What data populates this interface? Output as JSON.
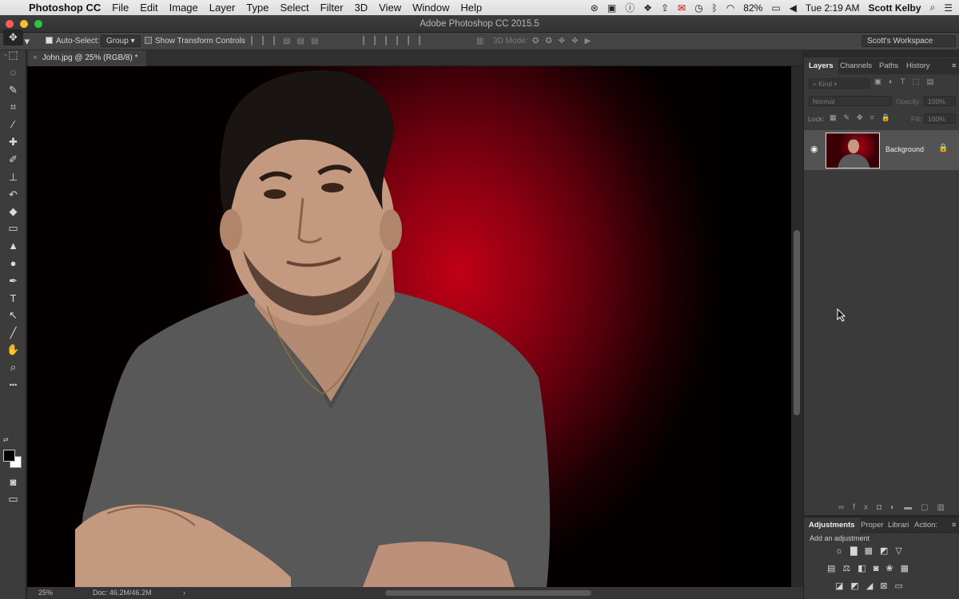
{
  "menubar": {
    "app_name": "Photoshop CC",
    "items": [
      "File",
      "Edit",
      "Image",
      "Layer",
      "Type",
      "Select",
      "Filter",
      "3D",
      "View",
      "Window",
      "Help"
    ],
    "battery": "82%",
    "clock": "Tue 2:19 AM",
    "user": "Scott Kelby"
  },
  "window": {
    "title": "Adobe Photoshop CC 2015.5"
  },
  "options": {
    "auto_select_label": "Auto-Select:",
    "auto_select_checked": true,
    "auto_select_value": "Group",
    "show_transform_label": "Show Transform Controls",
    "mode_3d_label": "3D Mode:",
    "workspace": "Scott's Workspace"
  },
  "document": {
    "tab_title": "John.jpg @ 25% (RGB/8) *",
    "zoom": "25%",
    "doc_info": "Doc: 46.2M/46.2M"
  },
  "tools": {
    "items": [
      {
        "icon": "move-icon",
        "glyph": "✥"
      },
      {
        "icon": "marquee-icon",
        "glyph": "⬚"
      },
      {
        "icon": "lasso-icon",
        "glyph": "◌"
      },
      {
        "icon": "quick-select-icon",
        "glyph": "✎"
      },
      {
        "icon": "crop-icon",
        "glyph": "⌗"
      },
      {
        "icon": "eyedropper-icon",
        "glyph": "⁄"
      },
      {
        "icon": "healing-icon",
        "glyph": "✚"
      },
      {
        "icon": "brush-icon",
        "glyph": "✐"
      },
      {
        "icon": "stamp-icon",
        "glyph": "⊥"
      },
      {
        "icon": "history-brush-icon",
        "glyph": "↶"
      },
      {
        "icon": "eraser-icon",
        "glyph": "◆"
      },
      {
        "icon": "gradient-icon",
        "glyph": "▭"
      },
      {
        "icon": "blur-icon",
        "glyph": "▲"
      },
      {
        "icon": "dodge-icon",
        "glyph": "●"
      },
      {
        "icon": "pen-icon",
        "glyph": "✒"
      },
      {
        "icon": "type-icon",
        "glyph": "T"
      },
      {
        "icon": "path-select-icon",
        "glyph": "↖"
      },
      {
        "icon": "line-icon",
        "glyph": "╱"
      },
      {
        "icon": "hand-icon",
        "glyph": "✋"
      },
      {
        "icon": "zoom-icon",
        "glyph": "⌕"
      },
      {
        "icon": "more-tools-icon",
        "glyph": "•••"
      }
    ]
  },
  "layers_panel": {
    "tabs": [
      "Layers",
      "Channels",
      "Paths",
      "History"
    ],
    "kind_placeholder": "Kind",
    "blend_mode": "Normal",
    "opacity_label": "Opacity:",
    "opacity_value": "100%",
    "lock_label": "Lock:",
    "fill_label": "Fill:",
    "fill_value": "100%",
    "layer_name": "Background"
  },
  "adjustments_panel": {
    "tabs": [
      "Adjustments",
      "Proper",
      "Librari",
      "Action:"
    ],
    "hint": "Add an adjustment"
  },
  "colors": {
    "foreground": "#000000",
    "background": "#ffffff",
    "backdrop_red": "#c10016"
  }
}
